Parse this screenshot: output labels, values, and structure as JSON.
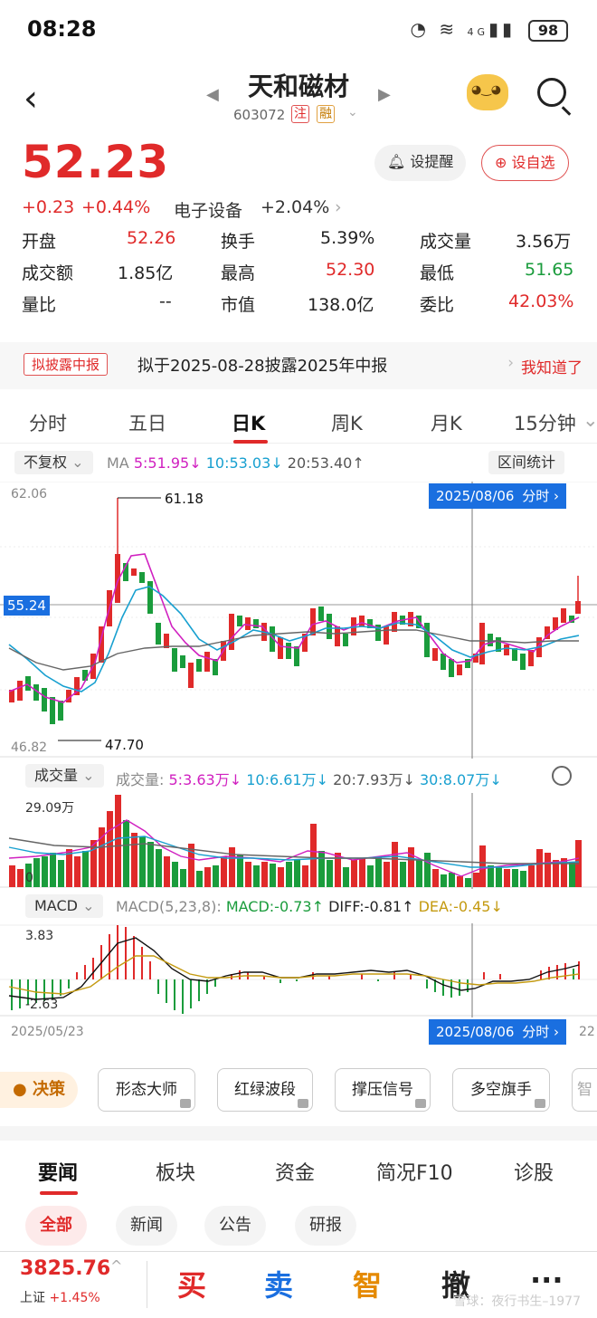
{
  "status_bar": {
    "time": "08:28",
    "battery": "98",
    "network": "4G"
  },
  "header": {
    "title": "天和磁材",
    "code": "603072",
    "tag_zhu": "注",
    "tag_rong": "融",
    "icons": [
      "back-icon",
      "prev-stock-icon",
      "next-stock-icon",
      "mascot-icon",
      "search-icon"
    ]
  },
  "quote": {
    "price": "52.23",
    "change": "+0.23",
    "change_pct": "+0.44%",
    "sector": "电子设备",
    "sector_pct": "+2.04%",
    "remind_label": "设提醒",
    "watch_label": "设自选",
    "accent": "#e02a2a",
    "down_color": "#1a9c3c"
  },
  "stats": [
    [
      {
        "k": "开盘",
        "v": "52.26",
        "c": "red"
      },
      {
        "k": "换手",
        "v": "5.39%",
        "c": "dark"
      },
      {
        "k": "成交量",
        "v": "3.56万",
        "c": "dark"
      }
    ],
    [
      {
        "k": "成交额",
        "v": "1.85亿",
        "c": "dark"
      },
      {
        "k": "最高",
        "v": "52.30",
        "c": "red"
      },
      {
        "k": "最低",
        "v": "51.65",
        "c": "green"
      }
    ],
    [
      {
        "k": "量比",
        "v": "--",
        "c": "dark"
      },
      {
        "k": "市值",
        "v": "138.0亿",
        "c": "dark"
      },
      {
        "k": "委比",
        "v": "42.03%",
        "c": "red"
      }
    ]
  ],
  "notice": {
    "tag": "拟披露中报",
    "text": "拟于2025-08-28披露2025年中报",
    "button": "我知道了"
  },
  "chart_tabs": [
    "分时",
    "五日",
    "日K",
    "周K",
    "月K",
    "15分钟"
  ],
  "chart_tabs_active": "日K",
  "ma_bar": {
    "adjust": "不复权",
    "ma": "MA",
    "ma5": "5:51.95↓",
    "ma10": "10:53.03↓",
    "ma20": "20:53.40↑",
    "stats_button": "区间统计"
  },
  "kline": {
    "y_top": "62.06",
    "y_bottom": "46.82",
    "current_tag": "55.24",
    "high_label": "61.18",
    "low_label": "47.70",
    "cursor_date": "2025/08/06",
    "cursor_link": "分时 ›"
  },
  "volume": {
    "label": "成交量",
    "prefix": "成交量:",
    "v5": "5:3.63万↓",
    "v10": "10:6.61万↓",
    "v20": "20:7.93万↓",
    "v30": "30:8.07万↓",
    "y_top": "29.09万",
    "y_zero": "0"
  },
  "macd": {
    "label": "MACD",
    "params": "MACD(5,23,8):",
    "macd": "MACD:-0.73↑",
    "diff": "DIFF:-0.81↑",
    "dea": "DEA:-0.45↓",
    "y_top": "3.83",
    "y_bottom": "-2.63",
    "start_date": "2025/05/23",
    "cursor_date": "2025/08/06",
    "cursor_link": "分时 ›",
    "end_fragment": "22"
  },
  "tools": {
    "decision": "决策",
    "items": [
      "形态大师",
      "红绿波段",
      "撑压信号",
      "多空旗手",
      "智"
    ]
  },
  "news_tabs": [
    "要闻",
    "板块",
    "资金",
    "简况F10",
    "诊股"
  ],
  "news_sub_tabs": [
    "全部",
    "新闻",
    "公告",
    "研报"
  ],
  "bottom": {
    "index_value": "3825.76",
    "index_name": "上证",
    "index_pct": "+1.45%",
    "buy": "买",
    "sell": "卖",
    "smart": "智",
    "cancel": "撤",
    "more": "···",
    "watermark": "雪球：夜行书生–1977"
  }
}
